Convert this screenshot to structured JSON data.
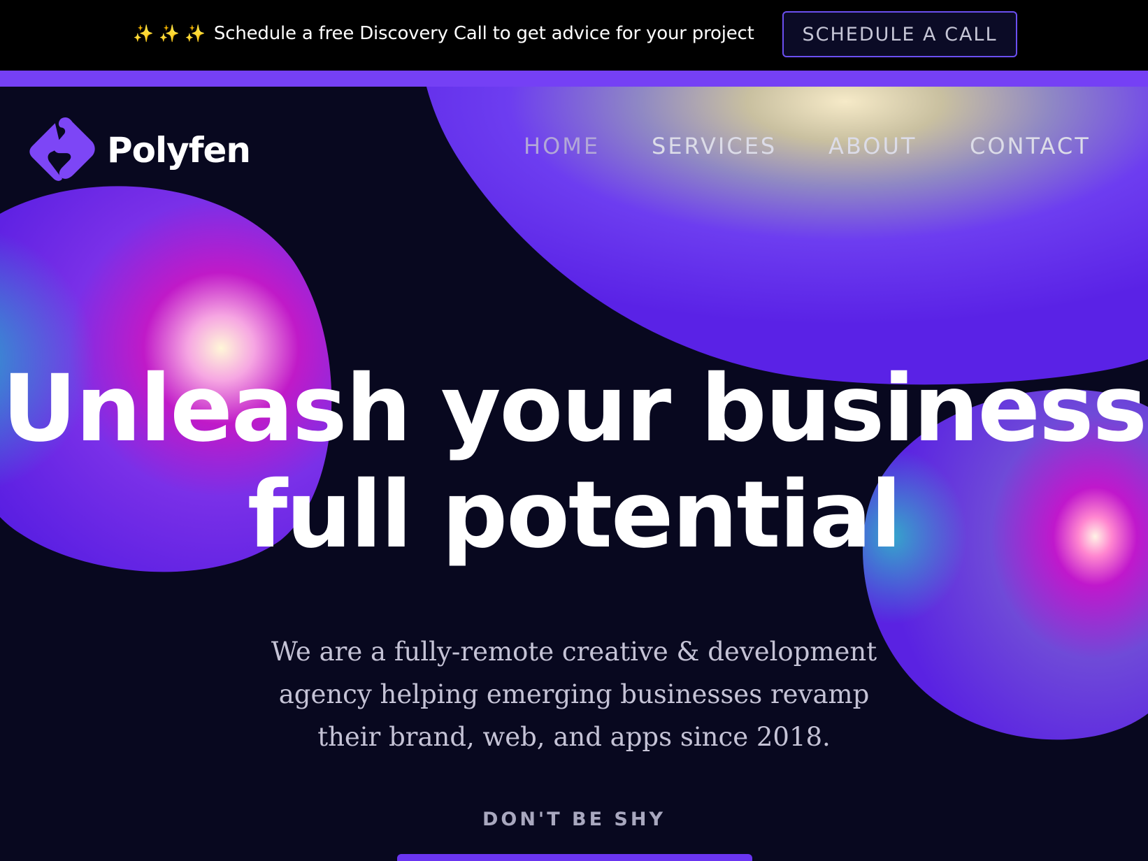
{
  "announcement": {
    "sparkles": "✨ ✨ ✨",
    "message": "Schedule a free Discovery Call to get advice for your project",
    "cta_label": "SCHEDULE A CALL"
  },
  "brand": {
    "name": "Polyfen",
    "logo_icon": "polyfen-diamond-icon"
  },
  "nav": {
    "items": [
      {
        "label": "HOME",
        "active": true
      },
      {
        "label": "SERVICES",
        "active": false
      },
      {
        "label": "ABOUT",
        "active": false
      },
      {
        "label": "CONTACT",
        "active": false
      }
    ]
  },
  "hero": {
    "headline_line1": "Unleash your business",
    "headline_line2": "full potential",
    "subtext": "We are a fully-remote creative & development agency helping emerging businesses revamp their brand, web, and apps since 2018.",
    "eyebrow": "DON'T BE SHY"
  },
  "colors": {
    "background": "#08081f",
    "accent": "#7540f5",
    "topbar": "#000000",
    "text": "#ffffff"
  }
}
